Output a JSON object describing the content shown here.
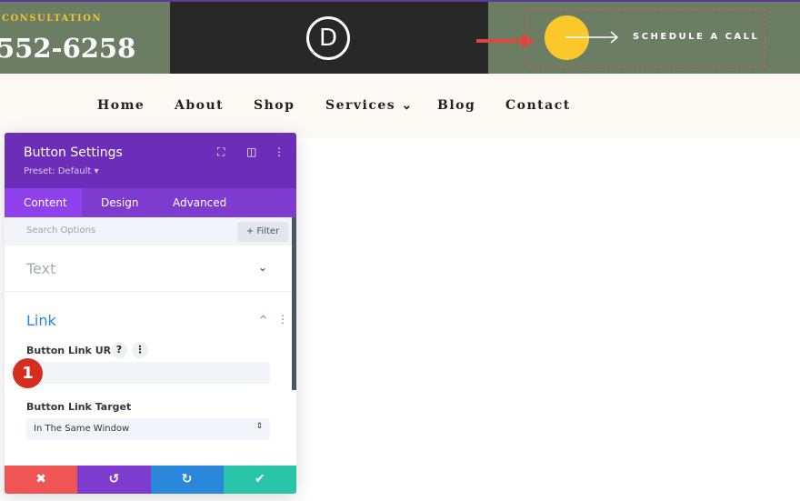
{
  "header": {
    "consultation": "CONSULTATION",
    "phone": "552-6258",
    "logo_letter": "D",
    "cta": "SCHEDULE A CALL"
  },
  "nav": {
    "items": [
      "Home",
      "About",
      "Shop",
      "Services ⌄",
      "Blog",
      "Contact"
    ]
  },
  "panel": {
    "title": "Button Settings",
    "preset": "Preset: Default ▾",
    "tabs": [
      "Content",
      "Design",
      "Advanced"
    ],
    "search_placeholder": "Search Options",
    "filter": "+ Filter",
    "sections": {
      "text": "Text",
      "link": "Link"
    },
    "link_url_label": "Button Link URL",
    "link_url_value": "",
    "link_target_label": "Button Link Target",
    "link_target_value": "In The Same Window",
    "badge": "1",
    "footer": {
      "cancel": "✖",
      "undo": "↺",
      "redo": "↻",
      "save": "✔"
    }
  },
  "colors": {
    "purple": "#6c2eb9",
    "green": "#6b7d63",
    "yellow": "#fbc82c",
    "red": "#ef5555",
    "blue": "#2b87da",
    "teal": "#29c4a9"
  }
}
